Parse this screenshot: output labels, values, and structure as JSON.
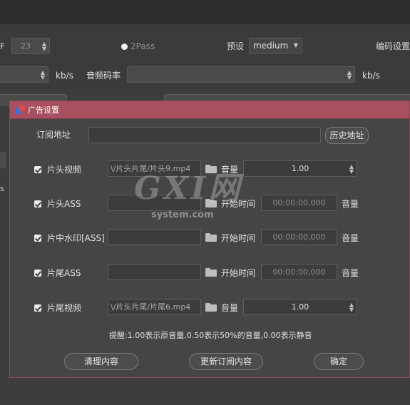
{
  "background": {
    "rf_value": "23",
    "rf_partial_label": "F",
    "twopass_label": "2Pass",
    "preset_label": "预设",
    "preset_value": "medium",
    "encode_settings_label": "编码设置",
    "kbs_unit_video": "kb/s",
    "audio_bitrate_label": "音频码率",
    "kbs_unit_audio": "kb/s",
    "side_glyph": "s"
  },
  "dialog": {
    "title": "广告设置",
    "subscribe_label": "订阅地址",
    "subscribe_value": "",
    "history_button": "历史地址",
    "rows": [
      {
        "checkbox_label": "片头视频",
        "path": "\\/片头片尾/片头9.mp4",
        "time_or_volume_label": "音量",
        "volume_value": "1.00"
      },
      {
        "checkbox_label": "片头ASS",
        "path": "",
        "time_or_volume_label": "开始时间",
        "time_value": "00:00:00,000",
        "trailing_label": "音量"
      },
      {
        "checkbox_label": "片中水印[ASS]",
        "path": "",
        "time_or_volume_label": "开始时间",
        "time_value": "00:00:00,000",
        "trailing_label": "音量"
      },
      {
        "checkbox_label": "片尾ASS",
        "path": "",
        "time_or_volume_label": "开始时间",
        "time_value": "00:00:00,000",
        "trailing_label": "音量"
      },
      {
        "checkbox_label": "片尾视频",
        "path": "\\/片头片尾/片尾6.mp4",
        "time_or_volume_label": "音量",
        "volume_value": "1.00"
      }
    ],
    "hint": "提醒:1.00表示原音量,0.50表示50%的音量,0.00表示静音",
    "clear_button": "清理内容",
    "update_button": "更新订阅内容",
    "confirm_button": "确定"
  },
  "watermark": {
    "big": "GXI网",
    "small": "system.com"
  },
  "colors": {
    "title_bar": "#a8505f",
    "dialog_bg": "#454545",
    "app_bg": "#3a3a3a",
    "logo_blue": "#3a6fd8",
    "logo_red": "#e24a4a"
  },
  "icons": [
    "spinner-arrows-icon",
    "dropdown-arrow-icon",
    "radio-dot-icon",
    "checkbox-checked-icon",
    "folder-icon",
    "app-logo-icon"
  ]
}
